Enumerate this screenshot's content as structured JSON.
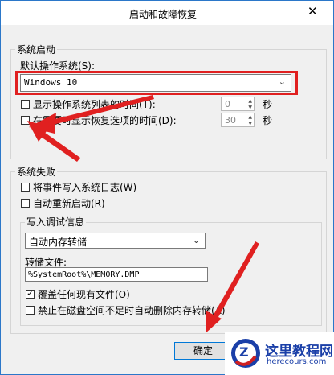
{
  "window": {
    "title": "启动和故障恢复",
    "close_glyph": "✕"
  },
  "startup": {
    "group_label": "系统启动",
    "default_os_label": "默认操作系统(S):",
    "default_os_value": "Windows 10",
    "show_list": {
      "label": "显示操作系统列表的时间(T):",
      "checked": false,
      "value": "0",
      "unit": "秒"
    },
    "show_recovery": {
      "label": "在需要时显示恢复选项的时间(D):",
      "checked": false,
      "value": "30",
      "unit": "秒"
    }
  },
  "failure": {
    "group_label": "系统失败",
    "write_event": {
      "label": "将事件写入系统日志(W)",
      "checked": false
    },
    "auto_restart": {
      "label": "自动重新启动(R)",
      "checked": false
    },
    "debug_group_label": "写入调试信息",
    "debug_type_value": "自动内存转储",
    "dump_file_label": "转储文件:",
    "dump_file_value": "%SystemRoot%\\MEMORY.DMP",
    "overwrite": {
      "label": "覆盖任何现有文件(O)",
      "checked": true
    },
    "disable_auto_delete": {
      "label": "禁止在磁盘空间不足时自动删除内存转储(A)",
      "checked": false
    }
  },
  "buttons": {
    "ok_label": "确定"
  },
  "watermark": {
    "site_name": "这里教程网",
    "site_url": "herecours.com",
    "logo_letter": "Z"
  },
  "colors": {
    "annotation_red": "#e02020",
    "accent_blue": "#0078d7"
  }
}
